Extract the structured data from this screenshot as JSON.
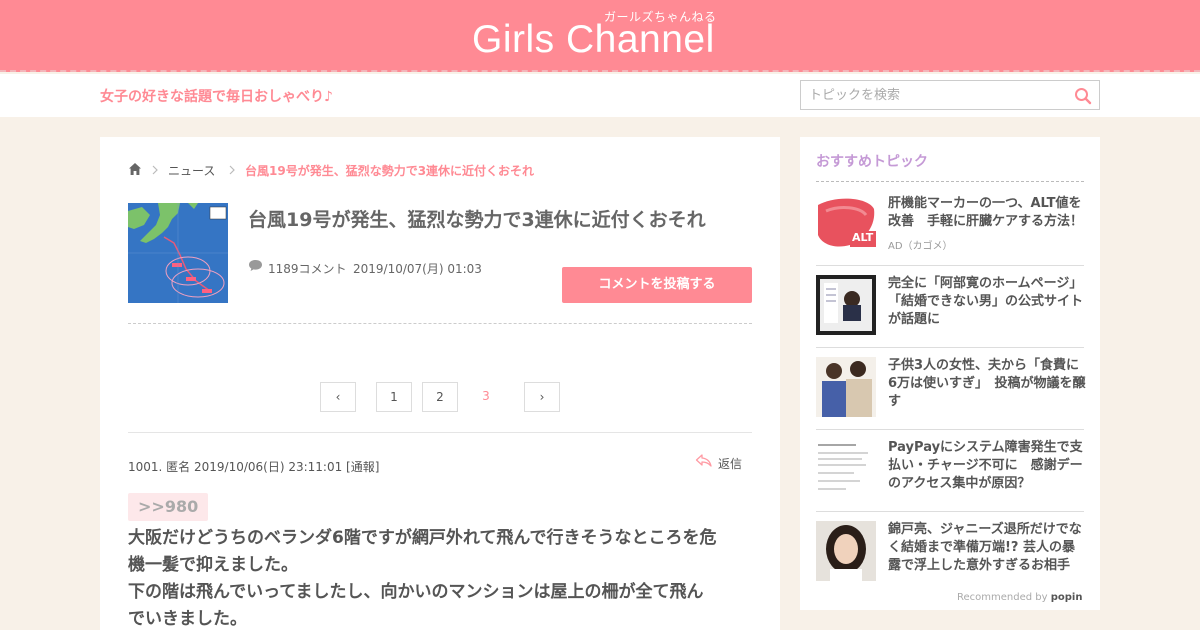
{
  "site": {
    "logo_text": "Girls Channel",
    "logo_subtitle": "ガールズちゃんねる",
    "tagline": "女子の好きな話題で毎日おしゃべり♪"
  },
  "search": {
    "placeholder": "トピックを検索"
  },
  "breadcrumb": {
    "section": "ニュース",
    "current": "台風19号が発生、猛烈な勢力で3連休に近付くおそれ"
  },
  "topic": {
    "title": "台風19号が発生、猛烈な勢力で3連休に近付くおそれ",
    "comment_count": "1189コメント",
    "date": "2019/10/07(月) 01:03",
    "post_button": "コメントを投稿する"
  },
  "pagination": {
    "prev": "‹",
    "pages": [
      "1",
      "2",
      "3"
    ],
    "current": "3",
    "next": "›"
  },
  "comment": {
    "header": "1001. 匿名 2019/10/06(日) 23:11:01 [通報]",
    "reply_label": "返信",
    "anchor": ">>980",
    "body_lines": [
      "大阪だけどうちのベランダ6階ですが網戸外れて飛んで行きそうなところを危",
      "機一髪で抑えました。",
      "下の階は飛んでいってましたし、向かいのマンションは屋上の柵が全て飛ん",
      "でいきました。"
    ]
  },
  "sidebar": {
    "heading": "おすすめトピック",
    "items": [
      {
        "title": "肝機能マーカーの一つ、ALT値を改善　手軽に肝臓ケアする方法！",
        "source": "AD（カゴメ）",
        "thumb_label": "ALT"
      },
      {
        "title": "完全に「阿部寛のホームページ」　「結婚できない男」の公式サイトが話題に",
        "source": ""
      },
      {
        "title": "子供3人の女性、夫から「食費に6万は使いすぎ」　投稿が物議を醸す",
        "source": ""
      },
      {
        "title": "PayPayにシステム障害発生で支払い・チャージ不可に　感謝デーのアクセス集中が原因？",
        "source": ""
      },
      {
        "title": "錦戸亮、ジャニーズ退所だけでなく結婚まで準備万端!? 芸人の暴露で浮上した意外すぎるお相手",
        "source": ""
      }
    ],
    "recommended_by": "Recommended by",
    "recommender": "popin"
  },
  "colors": {
    "brand_pink": "#ff8a94",
    "background": "#f8f1e8",
    "sidebar_heading": "#c59ad6"
  }
}
